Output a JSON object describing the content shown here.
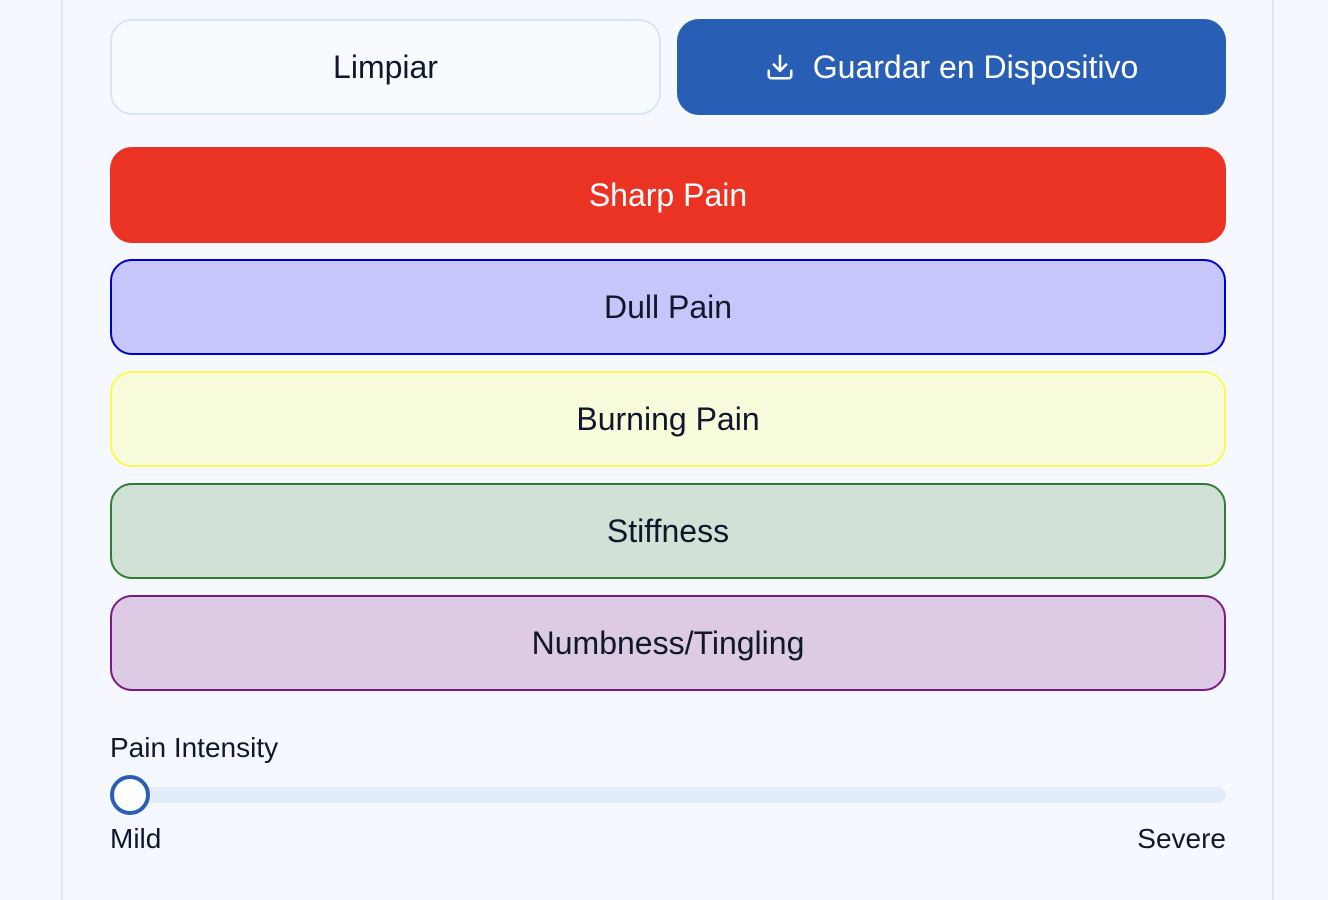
{
  "actions": {
    "clear_label": "Limpiar",
    "save_label": "Guardar en Dispositivo",
    "save_icon": "download-icon"
  },
  "pain_types": [
    {
      "label": "Sharp Pain",
      "fill": "#ea3323",
      "border": "#ea3323",
      "selected": true
    },
    {
      "label": "Dull Pain",
      "fill": "#c6c6fb",
      "border": "#0000c8",
      "selected": false
    },
    {
      "label": "Burning Pain",
      "fill": "#f7fadb",
      "border": "#fafa56",
      "selected": false
    },
    {
      "label": "Stiffness",
      "fill": "#d2e1d6",
      "border": "#2e7d32",
      "selected": false
    },
    {
      "label": "Numbness/Tingling",
      "fill": "#ddcbe6",
      "border": "#7b1a7f",
      "selected": false
    }
  ],
  "intensity": {
    "label": "Pain Intensity",
    "min_label": "Mild",
    "max_label": "Severe",
    "value_fraction": 0
  },
  "colors": {
    "accent": "#285fb5",
    "background": "#f5f9ff"
  }
}
